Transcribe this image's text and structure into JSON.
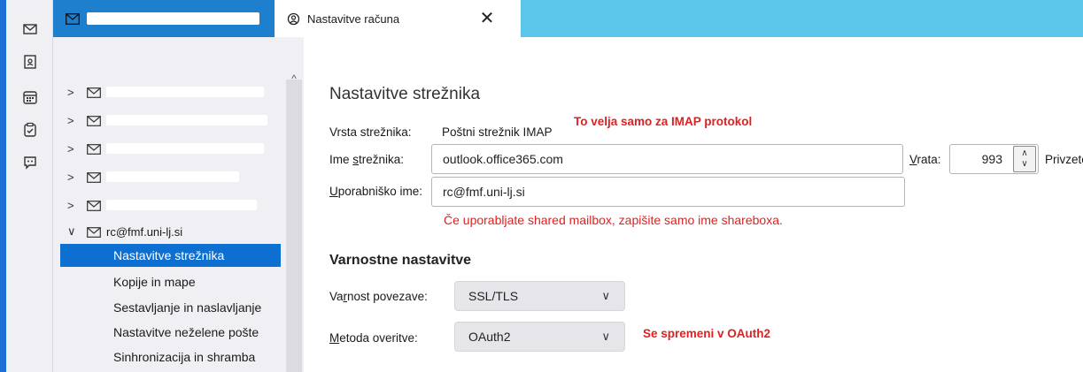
{
  "tabs": {
    "settings_label": "Nastavitve računa",
    "close_symbol": "✕"
  },
  "sidebar": {
    "account_label": "rc@fmf.uni-lj.si",
    "items": [
      "Nastavitve strežnika",
      "Kopije in mape",
      "Sestavljanje in naslavljanje",
      "Nastavitve neželene pošte",
      "Sinhronizacija in shramba"
    ]
  },
  "main": {
    "title": "Nastavitve strežnika",
    "server_type_label": "Vrsta strežnika:",
    "server_type_value": "Poštni strežnik IMAP",
    "imap_note": "To velja samo za IMAP protokol",
    "hostname_label_pre": "Ime ",
    "hostname_label_u": "s",
    "hostname_label_post": "trežnika:",
    "hostname_value": "outlook.office365.com",
    "port_label_u": "V",
    "port_label_post": "rata:",
    "port_value": "993",
    "default_label": "Privzeto",
    "username_label_u": "U",
    "username_label_post": "porabniško ime:",
    "username_value": "rc@fmf.uni-lj.si",
    "shared_note": "Če uporabljate shared mailbox, zapišite samo ime shareboxa.",
    "security_heading": "Varnostne nastavitve",
    "connection_label_pre": "Va",
    "connection_label_u": "r",
    "connection_label_post": "nost povezave:",
    "connection_value": "SSL/TLS",
    "auth_label_u": "M",
    "auth_label_post": "etoda overitve:",
    "auth_value": "OAuth2",
    "auth_note": "Se spremeni v OAuth2"
  },
  "colors": {
    "accent": "#0d6fd1",
    "tabbar": "#5bc6ea",
    "note": "#e02020"
  }
}
